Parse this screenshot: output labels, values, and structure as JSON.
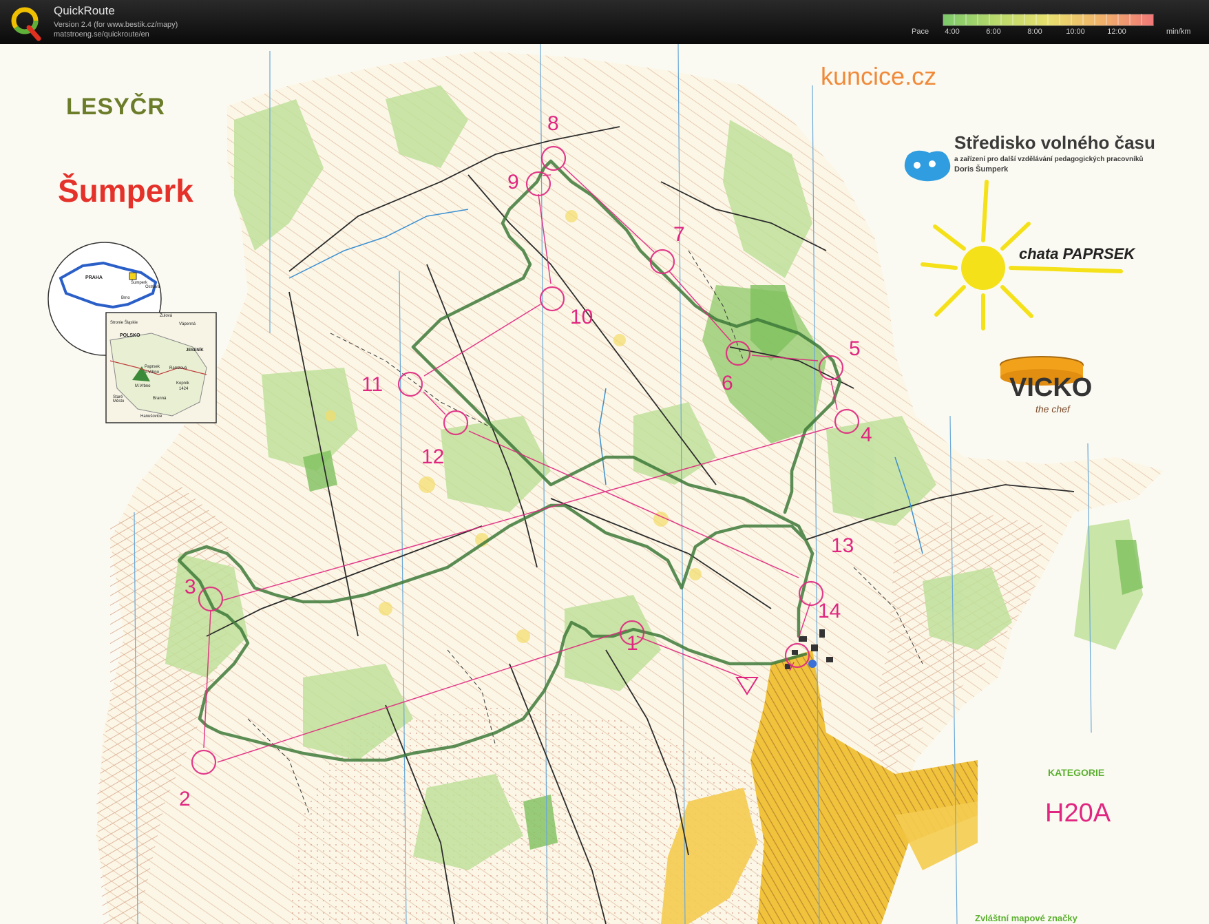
{
  "app": {
    "title": "QuickRoute",
    "version": "Version 2.4  (for www.bestik.cz/mapy)",
    "url": "matstroeng.se/quickroute/en"
  },
  "pace": {
    "label": "Pace",
    "ticks": [
      "4:00",
      "6:00",
      "8:00",
      "10:00",
      "12:00"
    ],
    "unit": "min/km",
    "colors": [
      "#7cc96a",
      "#e8e06e",
      "#f07878"
    ]
  },
  "map": {
    "course_color": "#e02680",
    "route_color": "#3e7a3a",
    "controls": [
      "1",
      "2",
      "3",
      "4",
      "5",
      "6",
      "7",
      "8",
      "9",
      "10",
      "11",
      "12",
      "13",
      "14"
    ],
    "sponsors": {
      "lesycr": "LESYČR",
      "sumperk": "Šumperk",
      "kuncice": "kuncice.cz",
      "doris_name": "Středisko volného času",
      "doris_sub": "a zařízení pro další vzdělávání pedagogických pracovníků",
      "doris_city": "Doris Šumperk",
      "paprsek": "chata PAPRSEK",
      "vicko": "VICKO",
      "vicko_sub": "the chef"
    },
    "kategorie_label": "KATEGORIE",
    "category": "H20A",
    "legend_title": "Zvláštní mapové značky",
    "inset": {
      "praha": "PRAHA",
      "sumperk": "Šumperk",
      "ostrava": "Ostrava",
      "brno": "Brno",
      "polsko": "POLSKO",
      "jesenik": "JESENÍK",
      "stronie": "Stronie Śląskie",
      "zulova": "Žulová",
      "vapenna": "Vápenná",
      "paprsek": "Paprsek",
      "velke_vrbno": "V.Vrbno",
      "ramzova": "Ramzová",
      "kopnik": "Kopník",
      "kopnik_height": "1424",
      "stare_mesto": "Staré Město",
      "male_vrbno": "M.Vrbno",
      "branna": "Branná",
      "hanusovice": "Hanušovice"
    }
  }
}
